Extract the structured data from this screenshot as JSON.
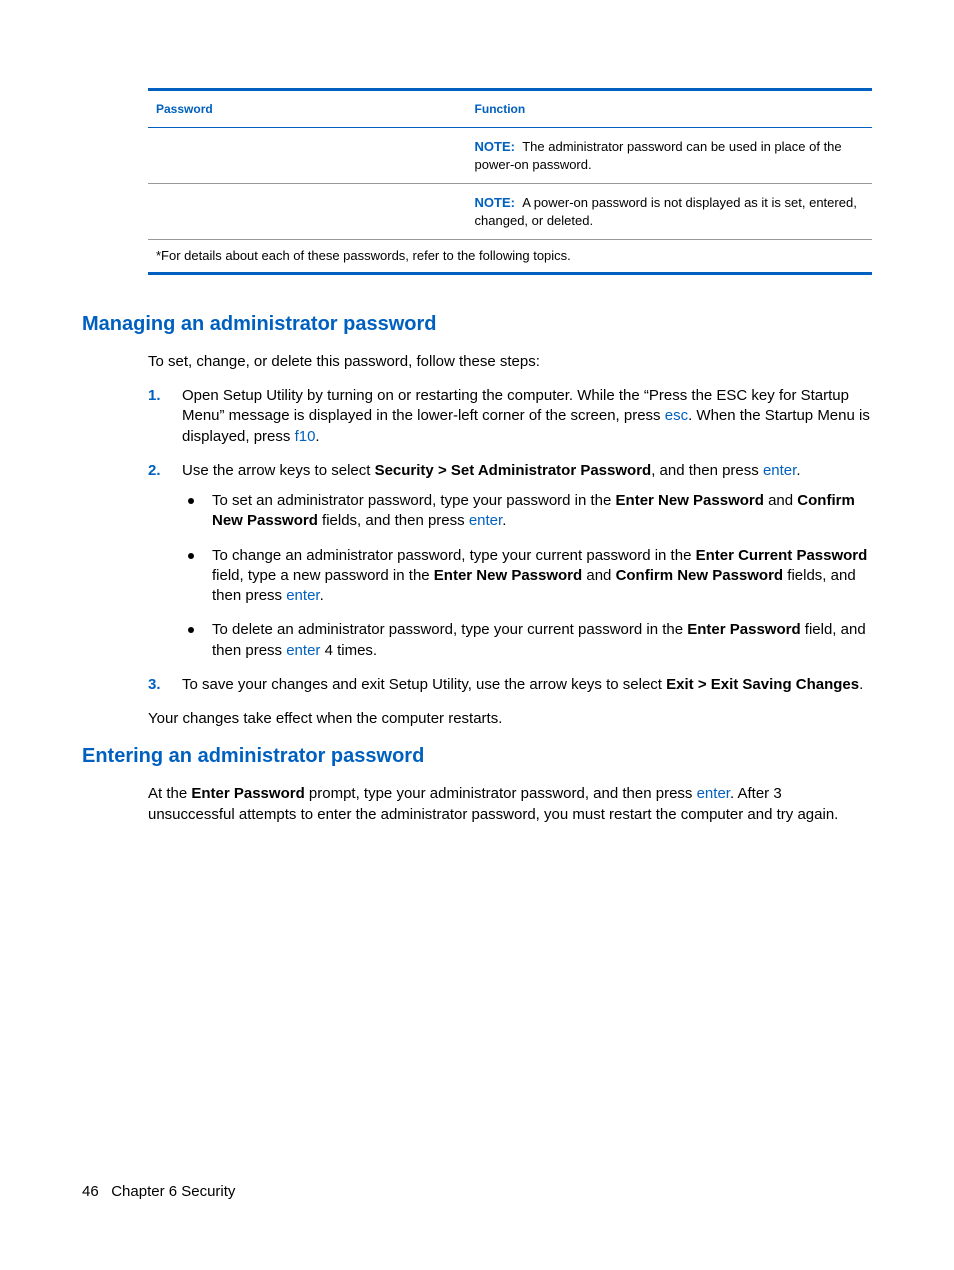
{
  "table": {
    "headers": {
      "password": "Password",
      "function": "Function"
    },
    "note_label": "NOTE:",
    "note1": "The administrator password can be used in place of the power-on password.",
    "note2": "A power-on password is not displayed as it is set, entered, changed, or deleted.",
    "footnote": "*For details about each of these passwords, refer to the following topics."
  },
  "section1": {
    "heading": "Managing an administrator password",
    "intro": "To set, change, or delete this password, follow these steps:",
    "step1_a": "Open Setup Utility by turning on or restarting the computer. While the “Press the ESC key for Startup Menu” message is displayed in the lower-left corner of the screen, press ",
    "step1_esc": "esc",
    "step1_b": ". When the Startup Menu is displayed, press ",
    "step1_f10": "f10",
    "step1_c": ".",
    "step2_a": "Use the arrow keys to select ",
    "step2_path": "Security > Set Administrator Password",
    "step2_b": ", and then press ",
    "step2_enter": "enter",
    "step2_c": ".",
    "bullet1_a": "To set an administrator password, type your password in the ",
    "bullet1_f1": "Enter New Password",
    "bullet1_b": " and ",
    "bullet1_f2": "Confirm New Password",
    "bullet1_c": " fields, and then press ",
    "bullet1_enter": "enter",
    "bullet1_d": ".",
    "bullet2_a": "To change an administrator password, type your current password in the ",
    "bullet2_f1": "Enter Current Password",
    "bullet2_b": " field, type a new password in the ",
    "bullet2_f2": "Enter New Password",
    "bullet2_c": " and ",
    "bullet2_f3": "Confirm New Password",
    "bullet2_d": " fields, and then press ",
    "bullet2_enter": "enter",
    "bullet2_e": ".",
    "bullet3_a": "To delete an administrator password, type your current password in the ",
    "bullet3_f1": "Enter Password",
    "bullet3_b": " field, and then press ",
    "bullet3_enter": "enter",
    "bullet3_c": " 4 times.",
    "step3_a": "To save your changes and exit Setup Utility, use the arrow keys to select ",
    "step3_path": "Exit > Exit Saving Changes",
    "step3_b": ".",
    "outro": "Your changes take effect when the computer restarts."
  },
  "section2": {
    "heading": "Entering an administrator password",
    "para_a": "At the ",
    "para_f1": "Enter Password",
    "para_b": " prompt, type your administrator password, and then press ",
    "para_enter": "enter",
    "para_c": ". After 3 unsuccessful attempts to enter the administrator password, you must restart the computer and try again."
  },
  "footer": {
    "page": "46",
    "chapter": "Chapter 6   Security"
  },
  "numbers": {
    "n1": "1.",
    "n2": "2.",
    "n3": "3."
  }
}
